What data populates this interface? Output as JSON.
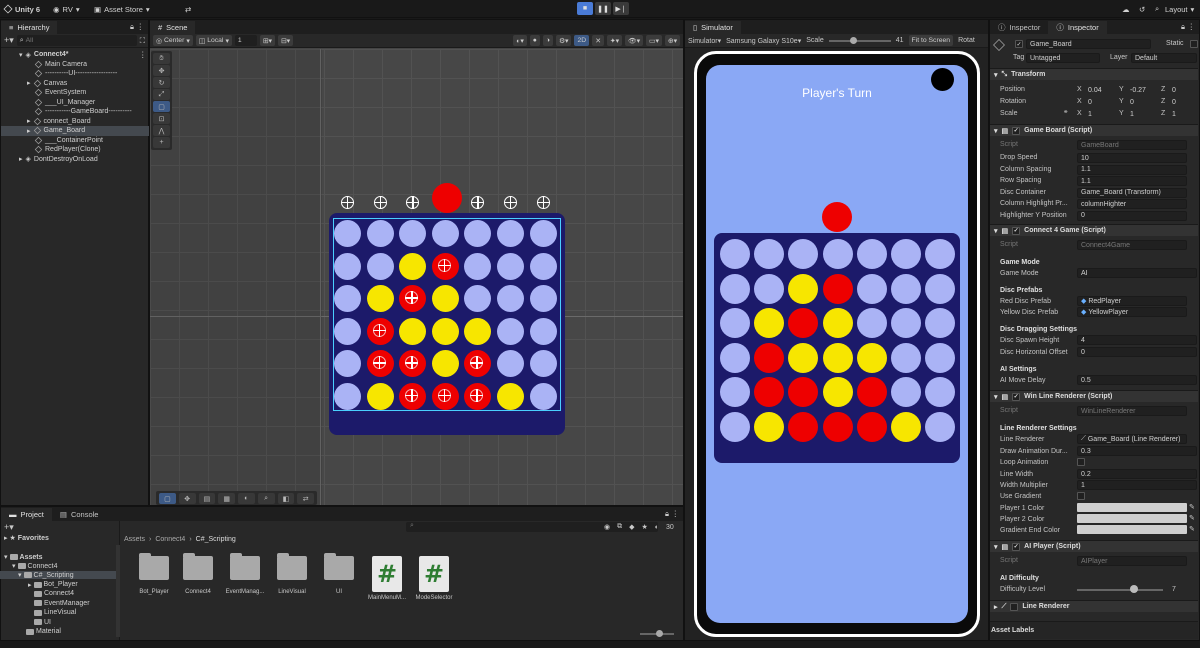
{
  "topbar": {
    "app": "Unity 6",
    "account": "RV",
    "asset_store": "Asset Store",
    "layout": "Layout"
  },
  "hierarchy": {
    "tab": "Hierarchy",
    "search_placeholder": "All",
    "items": [
      {
        "label": "Connect4*"
      },
      {
        "label": "Main Camera"
      },
      {
        "label": "----------UI------------------"
      },
      {
        "label": "Canvas"
      },
      {
        "label": "EventSystem"
      },
      {
        "label": "___UI_Manager"
      },
      {
        "label": "-----------GameBoard----------"
      },
      {
        "label": "connect_Board"
      },
      {
        "label": "Game_Board"
      },
      {
        "label": "___ContainerPoint"
      },
      {
        "label": "RedPlayer(Clone)"
      },
      {
        "label": "DontDestroyOnLoad"
      }
    ]
  },
  "scene": {
    "tab": "Scene",
    "pivot": "Center",
    "space": "Local",
    "snap": "1",
    "mode_2d": "2D",
    "board": [
      [
        "e",
        "e",
        "e",
        "e",
        "e",
        "e",
        "e"
      ],
      [
        "e",
        "e",
        "y",
        "r",
        "e",
        "e",
        "e"
      ],
      [
        "e",
        "y",
        "r",
        "y",
        "e",
        "e",
        "e"
      ],
      [
        "e",
        "r",
        "y",
        "y",
        "y",
        "e",
        "e"
      ],
      [
        "e",
        "r",
        "r",
        "y",
        "r",
        "e",
        "e"
      ],
      [
        "e",
        "y",
        "r",
        "r",
        "r",
        "y",
        "e"
      ]
    ]
  },
  "simulator": {
    "tab": "Simulator",
    "mode": "Simulator",
    "device": "Samsung Galaxy S10e",
    "scale_label": "Scale",
    "scale_value": "41",
    "fit_label": "Fit to Screen",
    "rotate_label": "Rotat",
    "turn_text": "Player's Turn",
    "board": [
      [
        "e",
        "e",
        "e",
        "e",
        "e",
        "e",
        "e"
      ],
      [
        "e",
        "e",
        "y",
        "r",
        "e",
        "e",
        "e"
      ],
      [
        "e",
        "y",
        "r",
        "y",
        "e",
        "e",
        "e"
      ],
      [
        "e",
        "r",
        "y",
        "y",
        "y",
        "e",
        "e"
      ],
      [
        "e",
        "r",
        "r",
        "y",
        "r",
        "e",
        "e"
      ],
      [
        "e",
        "y",
        "r",
        "r",
        "r",
        "y",
        "e"
      ]
    ]
  },
  "project": {
    "tabs": [
      "Project",
      "Console"
    ],
    "favorites": "Favorites",
    "tree": [
      "Assets",
      "Connect4",
      "C#_Scripting",
      "Bot_Player",
      "Connect4",
      "EventManager",
      "LineVisual",
      "UI",
      "Material"
    ],
    "breadcrumb": [
      "Assets",
      "Connect4",
      "C#_Scripting"
    ],
    "count": "30",
    "assets": [
      {
        "label": "Bot_Player",
        "kind": "folder"
      },
      {
        "label": "Connect4",
        "kind": "folder"
      },
      {
        "label": "EventManag...",
        "kind": "folder"
      },
      {
        "label": "LineVisual",
        "kind": "folder"
      },
      {
        "label": "UI",
        "kind": "folder"
      },
      {
        "label": "MainMenuM...",
        "kind": "script"
      },
      {
        "label": "ModeSelector",
        "kind": "script"
      }
    ]
  },
  "inspector": {
    "tabs": [
      "Inspector",
      "Inspector"
    ],
    "object_name": "Game_Board",
    "static_label": "Static",
    "tag_label": "Tag",
    "tag": "Untagged",
    "layer_label": "Layer",
    "layer": "Default",
    "transform": {
      "title": "Transform",
      "position": {
        "label": "Position",
        "x": "0.04",
        "y": "-0.27",
        "z": "0"
      },
      "rotation": {
        "label": "Rotation",
        "x": "0",
        "y": "0",
        "z": "0"
      },
      "scale": {
        "label": "Scale",
        "x": "1",
        "y": "1",
        "z": "1"
      }
    },
    "game_board": {
      "title": "Game Board (Script)",
      "script_label": "Script",
      "script": "GameBoard",
      "fields": [
        {
          "label": "Drop Speed",
          "value": "10"
        },
        {
          "label": "Column Spacing",
          "value": "1.1"
        },
        {
          "label": "Row Spacing",
          "value": "1.1"
        },
        {
          "label": "Disc Container",
          "value": "Game_Board (Transform)"
        },
        {
          "label": "Column Highlight Pr...",
          "value": "columnHighter"
        },
        {
          "label": "Highlighter Y Position",
          "value": "0"
        }
      ]
    },
    "connect4_game": {
      "title": "Connect 4 Game (Script)",
      "script_label": "Script",
      "script": "Connect4Game",
      "mode_header": "Game Mode",
      "mode_label": "Game Mode",
      "mode": "AI",
      "prefabs_header": "Disc Prefabs",
      "red_label": "Red Disc Prefab",
      "red": "RedPlayer",
      "yellow_label": "Yellow Disc Prefab",
      "yellow": "YellowPlayer",
      "drag_header": "Disc Dragging Settings",
      "spawn_label": "Disc Spawn Height",
      "spawn": "4",
      "offset_label": "Disc Horizontal Offset",
      "offset": "0",
      "ai_header": "AI Settings",
      "delay_label": "AI Move Delay",
      "delay": "0.5"
    },
    "win_line": {
      "title": "Win Line Renderer (Script)",
      "script_label": "Script",
      "script": "WinLineRenderer",
      "settings_header": "Line Renderer Settings",
      "renderer_label": "Line Renderer",
      "renderer": "Game_Board (Line Renderer)",
      "duration_label": "Draw Animation Dur...",
      "duration": "0.3",
      "loop_label": "Loop Animation",
      "width_label": "Line Width",
      "width": "0.2",
      "mult_label": "Width Multiplier",
      "mult": "1",
      "gradient_label": "Use Gradient",
      "p1_label": "Player 1 Color",
      "p2_label": "Player 2 Color",
      "end_label": "Gradient End Color"
    },
    "ai_player": {
      "title": "AI Player (Script)",
      "script_label": "Script",
      "script": "AIPlayer",
      "header": "AI Difficulty",
      "level_label": "Difficulty Level",
      "level": "7"
    },
    "line_renderer_title": "Line Renderer",
    "asset_labels": "Asset Labels"
  },
  "colors": {
    "red": "#ee0000",
    "yellow": "#f7e600",
    "empty": "#aab3f5",
    "board": "#1c1a6a",
    "sim_bg": "#8aa8f5"
  }
}
